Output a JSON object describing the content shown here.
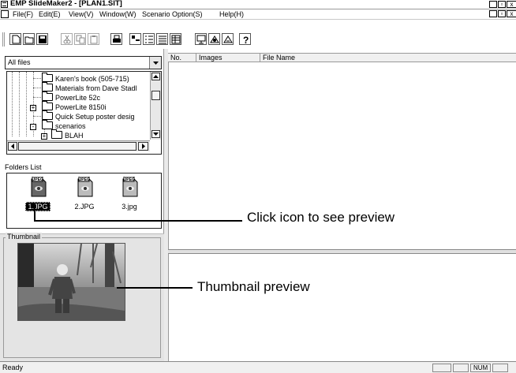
{
  "window": {
    "title": "EMP SlideMaker2 - [PLAN1.SIT]",
    "min_label": "_",
    "restore_label": "▫",
    "close_label": "x"
  },
  "menu": [
    "File(F)",
    "Edit(E)",
    "View(V)",
    "Window(W)",
    "Scenario Option(S)",
    "Help(H)"
  ],
  "combo": {
    "value": "All files"
  },
  "tree": {
    "items": [
      {
        "label": "Karen's book (505-715)"
      },
      {
        "label": "Materials from Dave Stadl"
      },
      {
        "label": "PowerLite 52c"
      },
      {
        "label": "PowerLite 8150i",
        "expander": "+"
      },
      {
        "label": "Quick Setup poster desig"
      },
      {
        "label": "scenarios",
        "expander": "-"
      },
      {
        "label": "BLAH",
        "expander": "+"
      }
    ]
  },
  "folders_list": {
    "label": "Folders List",
    "files": [
      {
        "name": "1.JPG",
        "badge": "JPEG",
        "selected": true
      },
      {
        "name": "2.JPG",
        "badge": "JPEG",
        "selected": false
      },
      {
        "name": "3.jpg",
        "badge": "JPEG",
        "selected": false
      }
    ]
  },
  "thumbnail": {
    "label": "Thumbnail"
  },
  "list_columns": [
    "No.",
    "Images",
    "File Name"
  ],
  "status": {
    "text": "Ready",
    "num": "NUM"
  },
  "callouts": {
    "click_icon": "Click icon to see preview",
    "thumbnail_preview": "Thumbnail preview"
  }
}
